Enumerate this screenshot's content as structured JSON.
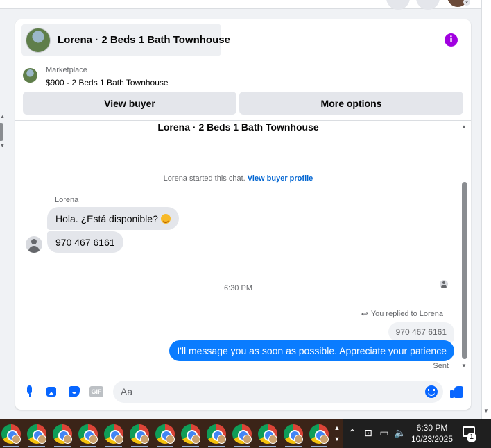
{
  "chat": {
    "header_title": "Lorena · 2 Beds 1 Bath Townhouse",
    "marketplace_label": "Marketplace",
    "listing": "$900 - 2 Beds 1 Bath Townhouse",
    "view_buyer_label": "View buyer",
    "more_options_label": "More options",
    "info_icon": "i"
  },
  "conversation": {
    "title": "Lorena · 2 Beds 1 Bath Townhouse",
    "started_text": "Lorena started this chat.",
    "view_profile_link": "View buyer profile",
    "sender_name": "Lorena",
    "incoming": [
      {
        "text": "Hola. ¿Está disponible?"
      },
      {
        "text": "970 467 6161"
      }
    ],
    "timestamp": "6:30 PM",
    "replied_label": "You replied to Lorena",
    "quoted_text": "970 467 6161",
    "outgoing_text": "I'll message you as soon as possible. Appreciate your patience",
    "status": "Sent"
  },
  "composer": {
    "placeholder": "Aa",
    "value": "",
    "gif_label": "GIF"
  },
  "taskbar": {
    "time": "6:30 PM",
    "date": "10/23/2025",
    "notification_count": "1",
    "app_count": 13
  },
  "colors": {
    "accent": "#0866ff",
    "outgoing_bubble": "#0a7cff",
    "incoming_bubble": "#e4e6eb",
    "info_icon": "#a100e0",
    "taskbar": "#3b2418"
  },
  "icons": [
    "microphone-icon",
    "photo-icon",
    "sticker-icon",
    "gif-icon",
    "emoji-icon",
    "like-icon",
    "info-icon",
    "reply-arrow-icon",
    "chrome-icon"
  ]
}
